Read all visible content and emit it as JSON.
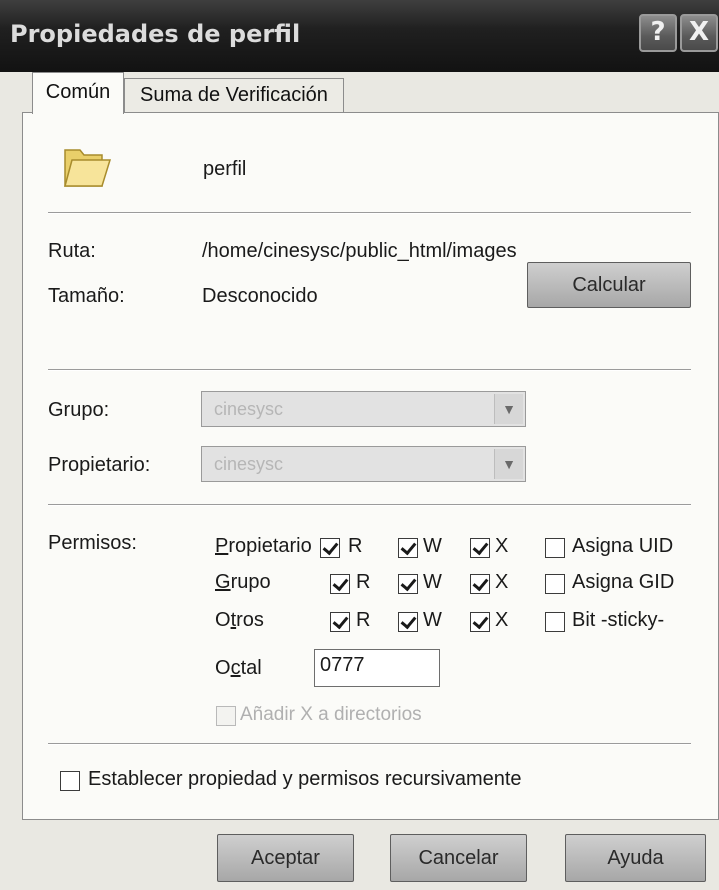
{
  "window": {
    "title": "Propiedades de perfil",
    "help_glyph": "?",
    "close_glyph": "X"
  },
  "tabs": [
    {
      "label": "Común",
      "active": true
    },
    {
      "label": "Suma de Verificación",
      "active": false
    }
  ],
  "item": {
    "name": "perfil",
    "icon": "folder-icon"
  },
  "info": {
    "path_label": "Ruta:",
    "path_value": "/home/cinesysc/public_html/images",
    "size_label": "Tamaño:",
    "size_value": "Desconocido",
    "calculate_label": "Calcular"
  },
  "ownership": {
    "group_label": "Grupo:",
    "group_value": "cinesysc",
    "owner_label": "Propietario:",
    "owner_value": "cinesysc"
  },
  "permissions": {
    "label": "Permisos:",
    "rows": [
      {
        "name_first": "P",
        "name_rest": "ropietario",
        "r": true,
        "w": true,
        "x": true,
        "special_label": "Asigna UID",
        "special": false
      },
      {
        "name_first": "G",
        "name_rest": "rupo",
        "r": true,
        "w": true,
        "x": true,
        "special_label": "Asigna GID",
        "special": false
      },
      {
        "name_first": "O",
        "name_mid": "t",
        "name_rest": "ros",
        "r": true,
        "w": true,
        "x": true,
        "special_label": "Bit -sticky-",
        "special": false
      }
    ],
    "r_label": "R",
    "w_label": "W",
    "x_label": "X",
    "octal_first": "O",
    "octal_mid": "c",
    "octal_rest": "tal",
    "octal_value": "0777",
    "add_x_label": "Añadir X a directorios"
  },
  "recursive": {
    "label": "Establecer propiedad y permisos recursivamente",
    "checked": false
  },
  "buttons": {
    "ok": "Aceptar",
    "cancel": "Cancelar",
    "help": "Ayuda"
  }
}
